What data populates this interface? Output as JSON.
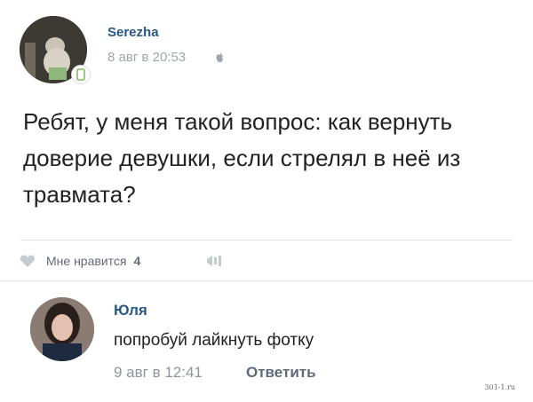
{
  "post": {
    "author": "Serezha",
    "date": "8 авг в 20:53",
    "platform_icon": "apple-icon",
    "text": "Ребят, у меня такой вопрос: как вернуть доверие девушки, если стрелял в неё из травмата?"
  },
  "likes": {
    "label": "Мне нравится",
    "count": "4"
  },
  "comment": {
    "author": "Юля",
    "text": "попробуй лайкнуть фотку",
    "date": "9 авг в 12:41",
    "reply_label": "Ответить"
  },
  "watermark": "301-1.ru",
  "colors": {
    "link_blue": "#2a5885",
    "muted": "#a0a6ad",
    "divider": "#e7e8ec"
  }
}
